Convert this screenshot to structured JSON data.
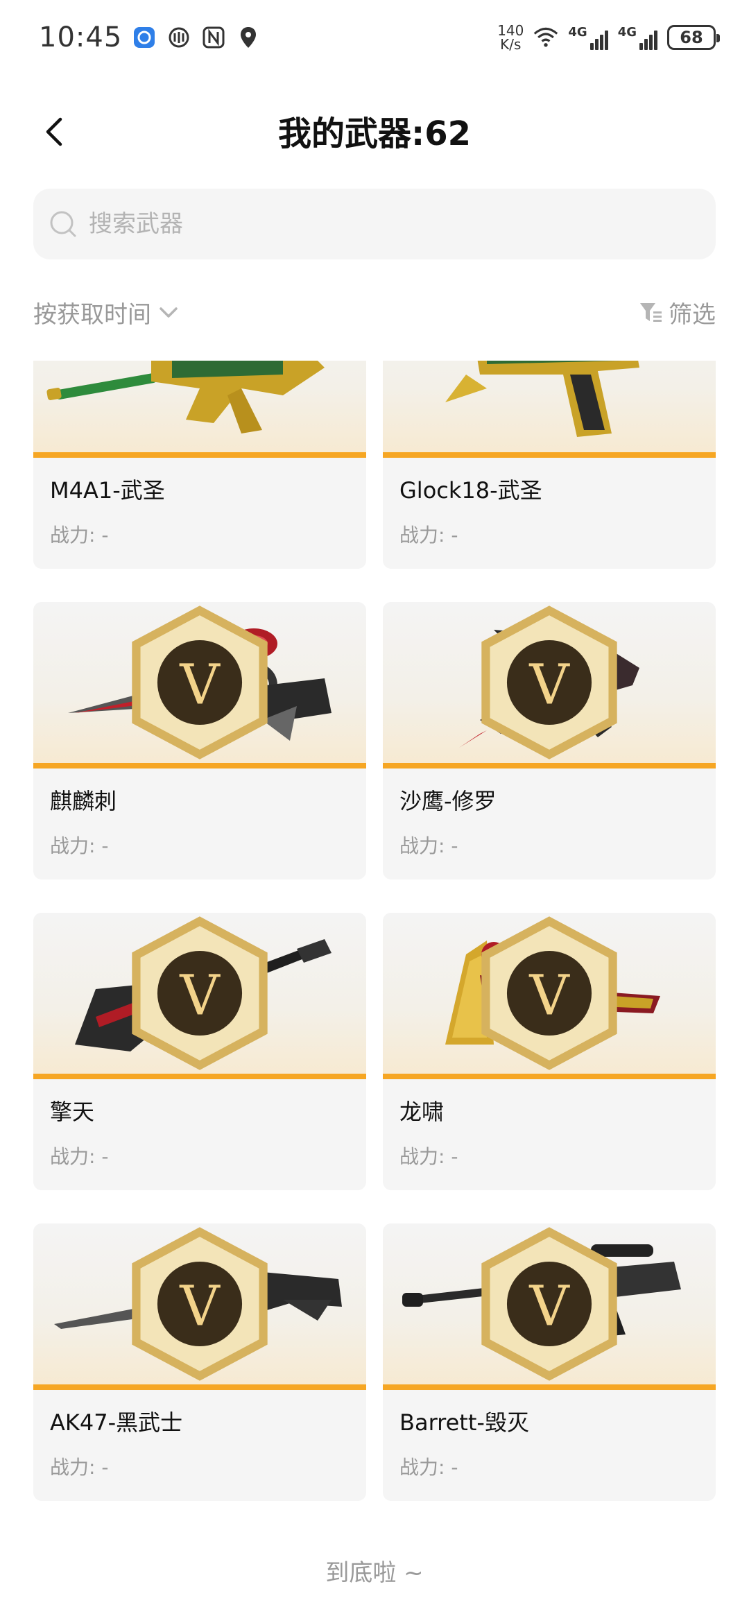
{
  "status_bar": {
    "time": "10:45",
    "net_speed_value": "140",
    "net_speed_unit": "K/s",
    "sim1_label": "4G",
    "sim2_label": "4G",
    "battery": "68"
  },
  "header": {
    "title": "我的武器:62"
  },
  "search": {
    "placeholder": "搜索武器",
    "value": ""
  },
  "sort": {
    "label": "按获取时间"
  },
  "filter": {
    "label": "筛选"
  },
  "weapons": [
    {
      "name": "M4A1-武圣",
      "power": "战力: -",
      "vip": false,
      "icon": "rifle-gold-icon"
    },
    {
      "name": "Glock18-武圣",
      "power": "战力: -",
      "vip": false,
      "icon": "pistol-gold-icon"
    },
    {
      "name": "麒麟刺",
      "power": "战力: -",
      "vip": true,
      "icon": "knuckle-knife-icon"
    },
    {
      "name": "沙鹰-修罗",
      "power": "战力: -",
      "vip": true,
      "icon": "desert-eagle-icon"
    },
    {
      "name": "擎天",
      "power": "战力: -",
      "vip": true,
      "icon": "shovel-icon"
    },
    {
      "name": "龙啸",
      "power": "战力: -",
      "vip": true,
      "icon": "axe-icon"
    },
    {
      "name": "AK47-黑武士",
      "power": "战力: -",
      "vip": true,
      "icon": "ak47-icon"
    },
    {
      "name": "Barrett-毁灭",
      "power": "战力: -",
      "vip": true,
      "icon": "sniper-rifle-icon"
    }
  ],
  "footer": {
    "end_text": "到底啦 ~"
  }
}
